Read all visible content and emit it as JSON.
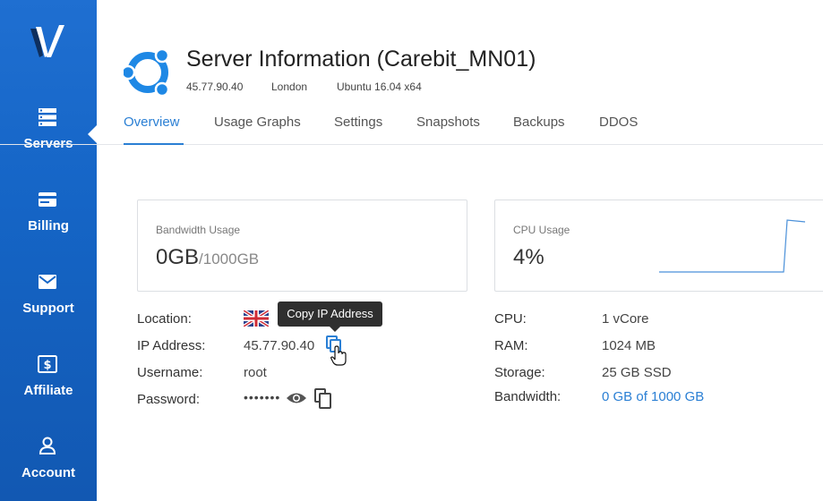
{
  "sidebar": {
    "logo_icon": "vultr-v-logo",
    "active_item": "Servers",
    "items": [
      {
        "label": "Servers",
        "icon": "servers-icon"
      },
      {
        "label": "Billing",
        "icon": "credit-card-icon"
      },
      {
        "label": "Support",
        "icon": "envelope-icon"
      },
      {
        "label": "Affiliate",
        "icon": "dollar-icon"
      },
      {
        "label": "Account",
        "icon": "user-icon"
      }
    ]
  },
  "header": {
    "os_icon": "ubuntu-logo-icon",
    "title": "Server Information (Carebit_MN01)",
    "ip": "45.77.90.40",
    "location": "London",
    "os": "Ubuntu 16.04 x64"
  },
  "tabs": [
    {
      "label": "Overview",
      "active": true
    },
    {
      "label": "Usage Graphs",
      "active": false
    },
    {
      "label": "Settings",
      "active": false
    },
    {
      "label": "Snapshots",
      "active": false
    },
    {
      "label": "Backups",
      "active": false
    },
    {
      "label": "DDOS",
      "active": false
    }
  ],
  "bandwidth_card": {
    "label": "Bandwidth Usage",
    "used": "0GB",
    "limit": "/1000GB"
  },
  "cpu_card": {
    "label": "CPU Usage",
    "value": "4%"
  },
  "details_left": {
    "location_label": "Location:",
    "location_flag": "uk-flag",
    "ip_label": "IP Address:",
    "ip_value": "45.77.90.40",
    "username_label": "Username:",
    "username_value": "root",
    "password_label": "Password:",
    "password_value": "•••••••"
  },
  "details_right": {
    "cpu_label": "CPU:",
    "cpu_value": "1 vCore",
    "ram_label": "RAM:",
    "ram_value": "1024 MB",
    "storage_label": "Storage:",
    "storage_value": "25 GB SSD",
    "bandwidth_label": "Bandwidth:",
    "bandwidth_value": "0 GB of 1000 GB"
  },
  "tooltip": {
    "text": "Copy IP Address"
  },
  "colors": {
    "sidebar": "#1565c6",
    "accent": "#2a7fd4",
    "ubuntu": "#1e88e5"
  }
}
